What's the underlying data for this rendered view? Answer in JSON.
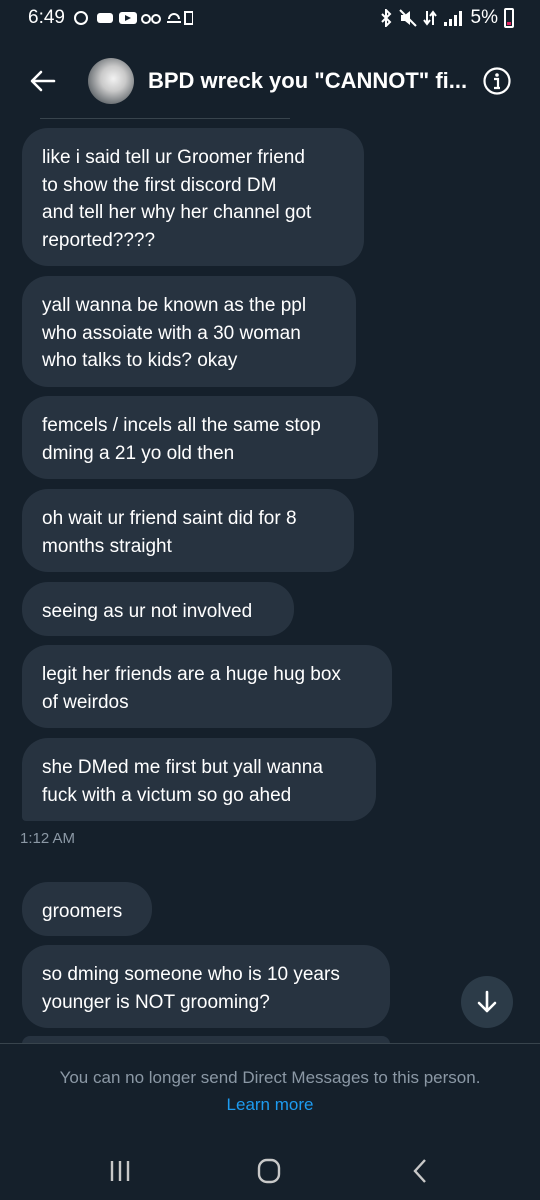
{
  "status_bar": {
    "time": "6:49",
    "battery": "5%"
  },
  "header": {
    "title": "BPD wreck you \"CANNOT\" fi...",
    "back_icon": "arrow-left-icon",
    "info_icon": "info-icon"
  },
  "messages": [
    {
      "text": "like i said tell ur Groomer friend\nto show the first discord DM\nand tell her why her channel got\nreported????"
    },
    {
      "text": "yall wanna be known as the ppl\nwho assoiate with a 30 woman\nwho talks to kids? okay"
    },
    {
      "text": "femcels / incels all the same stop\ndming a 21 yo old then"
    },
    {
      "text": "oh wait ur friend saint did for 8\nmonths straight"
    },
    {
      "text": "seeing as ur not involved"
    },
    {
      "text": "legit her friends are a huge hug box\nof weirdos"
    },
    {
      "text": "she DMed me first but yall wanna\nfuck with a victum so go ahed"
    },
    {
      "text": "groomers"
    },
    {
      "text": "so dming someone who is 10 years\nyounger is NOT grooming?"
    }
  ],
  "timestamp": "1:12 AM",
  "footer": {
    "notice": "You can no longer send Direct Messages to this person.",
    "learn_more": "Learn more"
  },
  "colors": {
    "background": "#15202b",
    "bubble": "#273340",
    "accent": "#1d9bf0",
    "muted": "#8b98a5"
  }
}
